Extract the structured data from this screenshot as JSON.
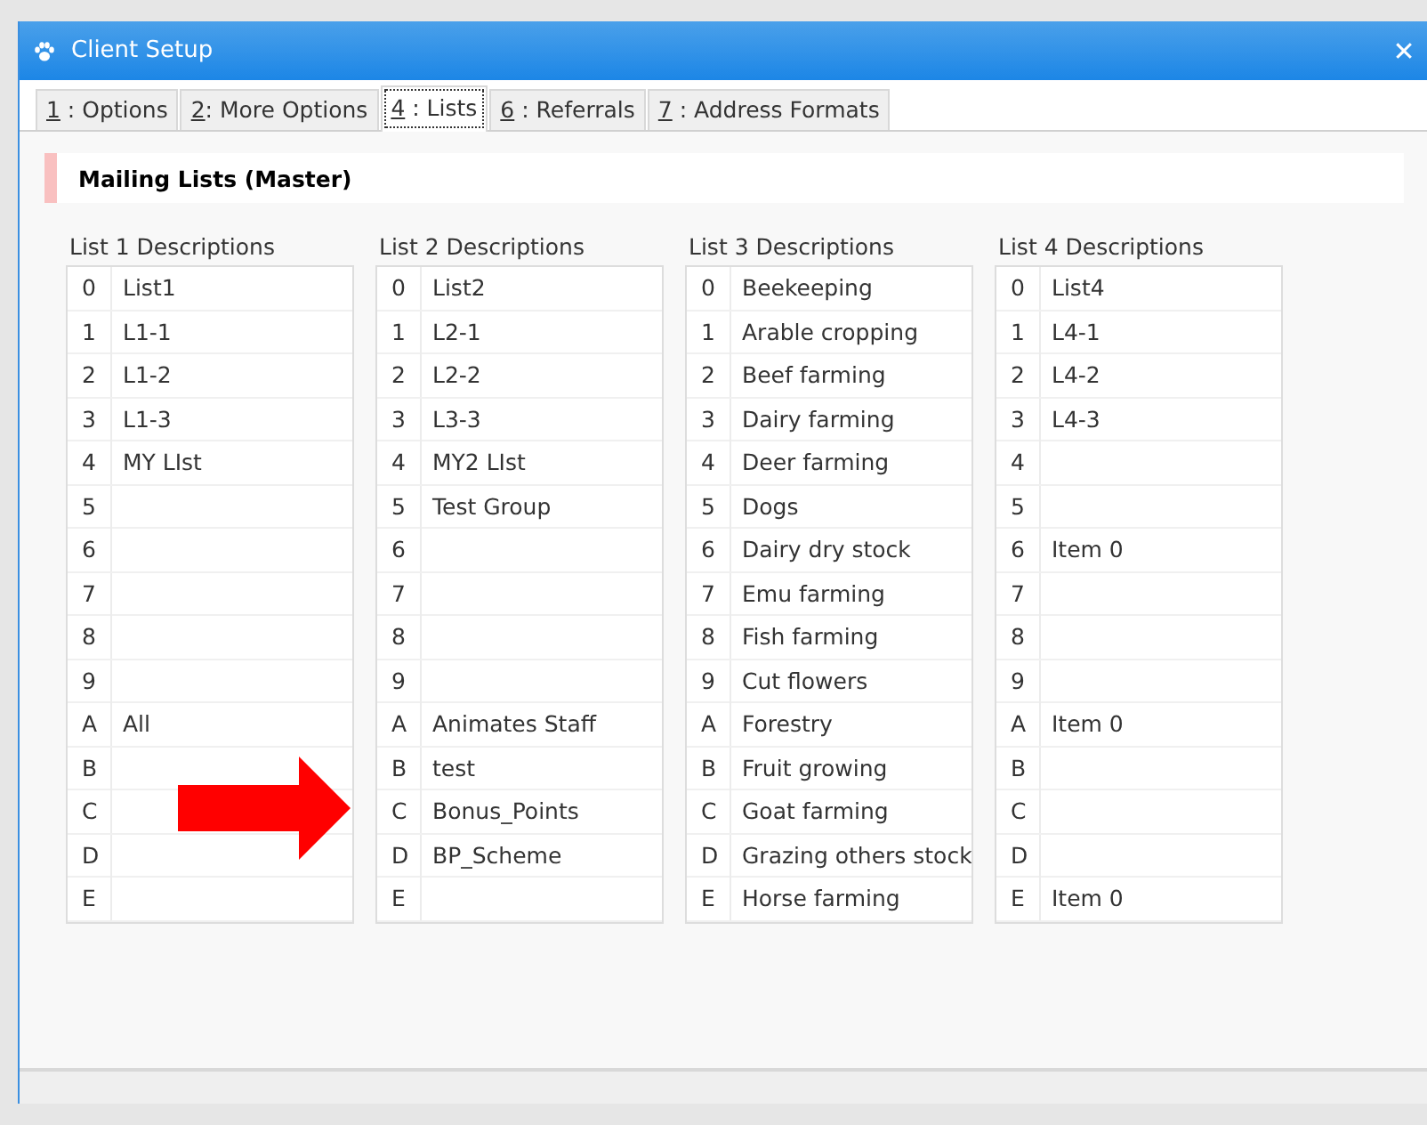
{
  "window": {
    "title": "Client Setup",
    "close": "✕"
  },
  "tabs": [
    {
      "label": "1 : Options",
      "selected": false
    },
    {
      "label": "2: More Options",
      "selected": false
    },
    {
      "label": "4 : Lists",
      "selected": true
    },
    {
      "label": "6 : Referrals",
      "selected": false
    },
    {
      "label": "7 : Address Formats",
      "selected": false
    }
  ],
  "section_title": "Mailing Lists (Master)",
  "lists": [
    {
      "heading": "List 1 Descriptions",
      "rows": [
        [
          "0",
          "List1"
        ],
        [
          "1",
          "L1-1"
        ],
        [
          "2",
          "L1-2"
        ],
        [
          "3",
          "L1-3"
        ],
        [
          "4",
          "MY LIst"
        ],
        [
          "5",
          ""
        ],
        [
          "6",
          ""
        ],
        [
          "7",
          ""
        ],
        [
          "8",
          ""
        ],
        [
          "9",
          ""
        ],
        [
          "A",
          "All"
        ],
        [
          "B",
          ""
        ],
        [
          "C",
          ""
        ],
        [
          "D",
          ""
        ],
        [
          "E",
          ""
        ]
      ]
    },
    {
      "heading": "List 2 Descriptions",
      "rows": [
        [
          "0",
          "List2"
        ],
        [
          "1",
          "L2-1"
        ],
        [
          "2",
          "L2-2"
        ],
        [
          "3",
          "L3-3"
        ],
        [
          "4",
          "MY2 LIst"
        ],
        [
          "5",
          "Test Group"
        ],
        [
          "6",
          ""
        ],
        [
          "7",
          ""
        ],
        [
          "8",
          ""
        ],
        [
          "9",
          ""
        ],
        [
          "A",
          "Animates Staff"
        ],
        [
          "B",
          "test"
        ],
        [
          "C",
          "Bonus_Points"
        ],
        [
          "D",
          "BP_Scheme"
        ],
        [
          "E",
          ""
        ]
      ]
    },
    {
      "heading": "List 3 Descriptions",
      "rows": [
        [
          "0",
          "Beekeeping"
        ],
        [
          "1",
          "Arable cropping"
        ],
        [
          "2",
          "Beef farming"
        ],
        [
          "3",
          "Dairy farming"
        ],
        [
          "4",
          "Deer farming"
        ],
        [
          "5",
          "Dogs"
        ],
        [
          "6",
          "Dairy dry stock"
        ],
        [
          "7",
          "Emu farming"
        ],
        [
          "8",
          "Fish farming"
        ],
        [
          "9",
          "Cut flowers"
        ],
        [
          "A",
          "Forestry"
        ],
        [
          "B",
          "Fruit growing"
        ],
        [
          "C",
          "Goat farming"
        ],
        [
          "D",
          "Grazing others stock"
        ],
        [
          "E",
          "Horse farming"
        ]
      ]
    },
    {
      "heading": "List 4 Descriptions",
      "rows": [
        [
          "0",
          "List4"
        ],
        [
          "1",
          "L4-1"
        ],
        [
          "2",
          "L4-2"
        ],
        [
          "3",
          "L4-3"
        ],
        [
          "4",
          ""
        ],
        [
          "5",
          ""
        ],
        [
          "6",
          "Item 0"
        ],
        [
          "7",
          ""
        ],
        [
          "8",
          ""
        ],
        [
          "9",
          ""
        ],
        [
          "A",
          "Item 0"
        ],
        [
          "B",
          ""
        ],
        [
          "C",
          ""
        ],
        [
          "D",
          ""
        ],
        [
          "E",
          "Item 0"
        ]
      ]
    }
  ]
}
